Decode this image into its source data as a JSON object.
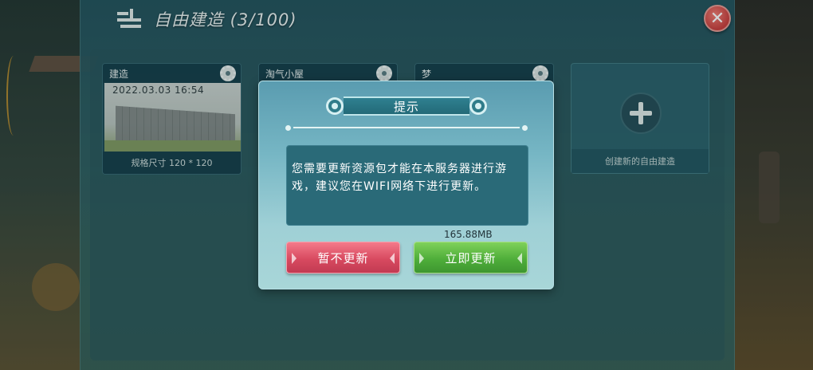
{
  "header": {
    "title": "自由建造 (3/100)",
    "title_icon": "building-icon",
    "close_icon": "close-icon"
  },
  "saves": [
    {
      "name": "建造",
      "date": "2022.03.03 16:54",
      "size_label": "规格尺寸 120 * 120",
      "settings_icon": "gear-icon"
    },
    {
      "name": "淘气小屋",
      "settings_icon": "gear-icon"
    },
    {
      "name": "梦",
      "settings_icon": "gear-icon"
    }
  ],
  "new_save": {
    "label": "创建新的自由建造",
    "icon": "plus-icon"
  },
  "dialog": {
    "title": "提示",
    "message": "您需要更新资源包才能在本服务器进行游戏，建议您在WIFI网络下进行更新。",
    "download_size": "165.88MB",
    "later_label": "暂不更新",
    "update_label": "立即更新"
  },
  "colors": {
    "later_button": "#d84a60",
    "update_button": "#4fae3a",
    "dialog_bg": "#76b6c4",
    "close_button": "#c83c3a"
  }
}
